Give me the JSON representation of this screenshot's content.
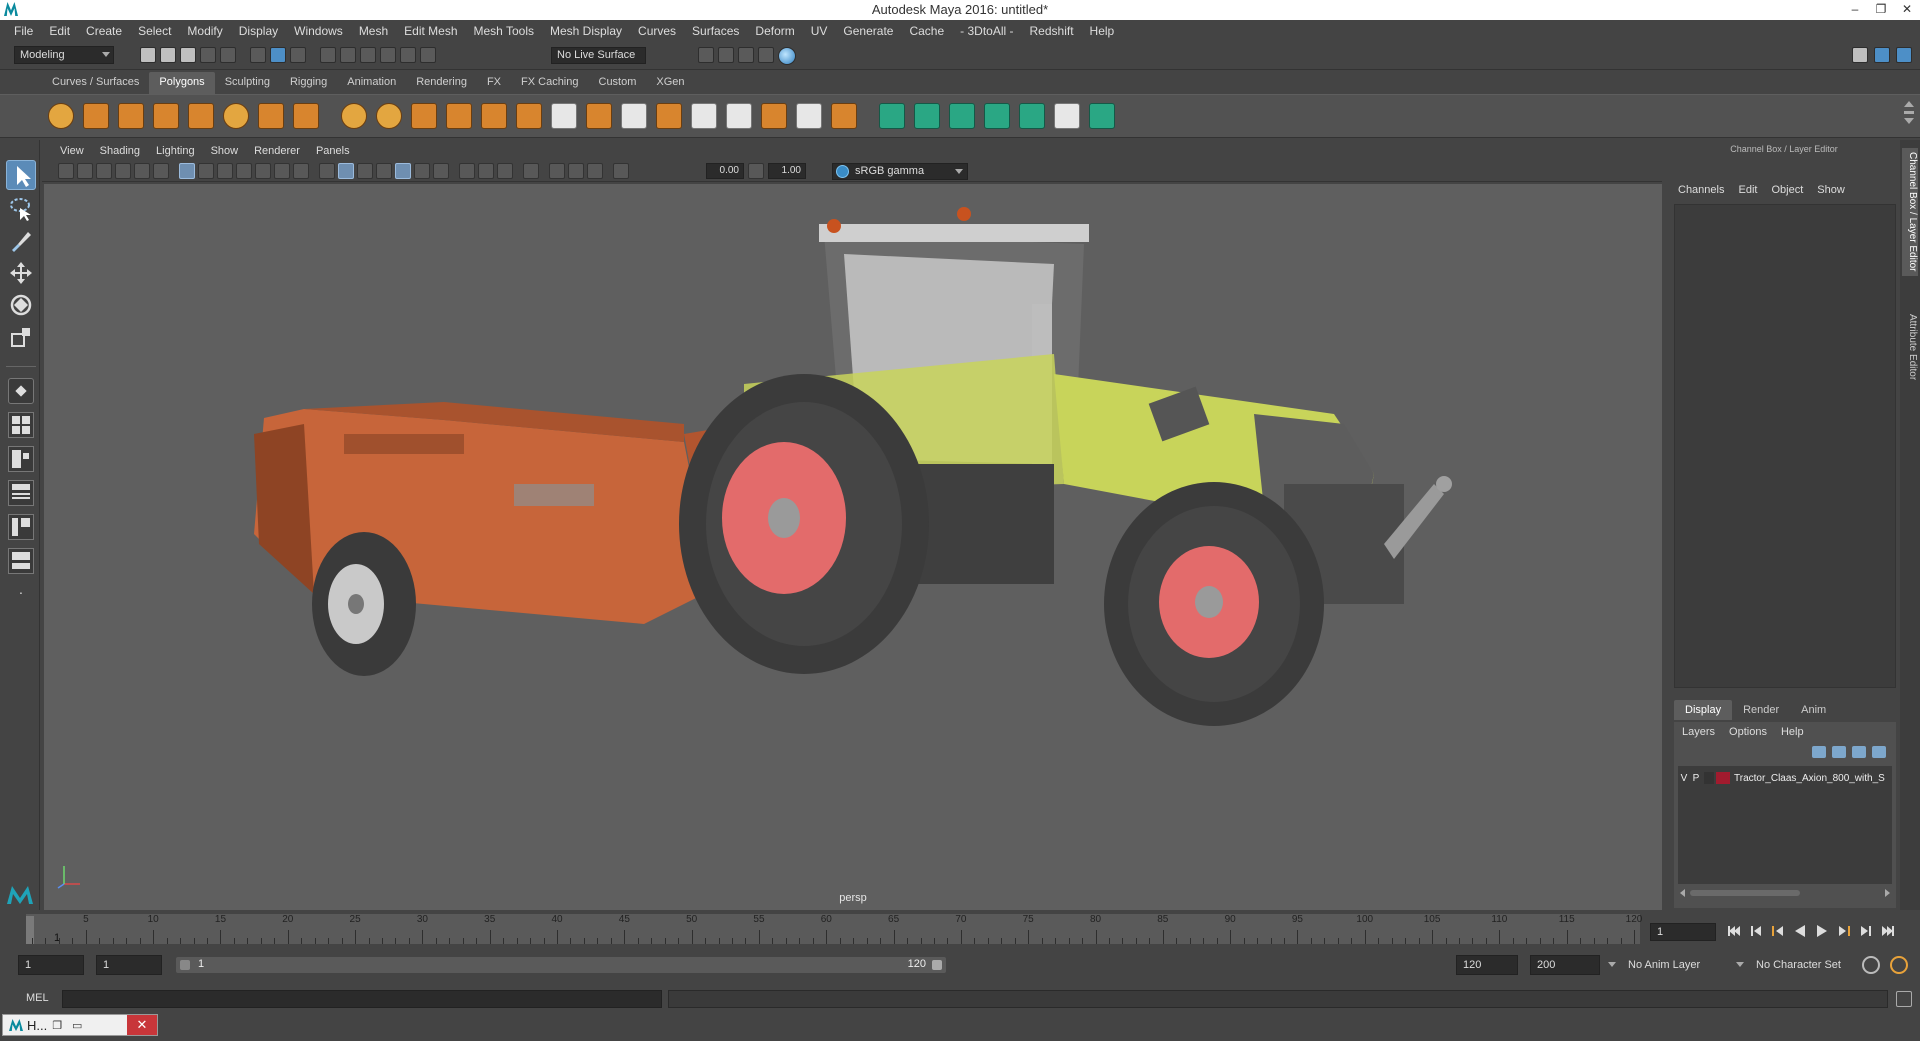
{
  "window": {
    "title": "Autodesk Maya 2016: untitled*",
    "minimize": "–",
    "restore": "❐",
    "close": "✕"
  },
  "menubar": [
    "File",
    "Edit",
    "Create",
    "Select",
    "Modify",
    "Display",
    "Windows",
    "Mesh",
    "Edit Mesh",
    "Mesh Tools",
    "Mesh Display",
    "Curves",
    "Surfaces",
    "Deform",
    "UV",
    "Generate",
    "Cache",
    "- 3DtoAll -",
    "Redshift",
    "Help"
  ],
  "statusline": {
    "mode": "Modeling",
    "live_surface": "No Live Surface"
  },
  "shelf": {
    "tabs": [
      "Curves / Surfaces",
      "Polygons",
      "Sculpting",
      "Rigging",
      "Animation",
      "Rendering",
      "FX",
      "FX Caching",
      "Custom",
      "XGen"
    ],
    "active_tab": "Polygons"
  },
  "viewport": {
    "menus": [
      "View",
      "Shading",
      "Lighting",
      "Show",
      "Renderer",
      "Panels"
    ],
    "near_value": "0.00",
    "far_value": "1.00",
    "color_space": "sRGB gamma",
    "camera_label": "persp"
  },
  "channel_box": {
    "header": "Channel Box / Layer Editor",
    "menus": [
      "Channels",
      "Edit",
      "Object",
      "Show"
    ]
  },
  "layer_editor": {
    "tabs": [
      "Display",
      "Render",
      "Anim"
    ],
    "active_tab": "Display",
    "menus": [
      "Layers",
      "Options",
      "Help"
    ],
    "layers": [
      {
        "visible": "V",
        "playback": "P",
        "color": "#a11b2e",
        "name": "Tractor_Claas_Axion_800_with_S"
      }
    ]
  },
  "side_tabs": [
    "Channel Box / Layer Editor",
    "Attribute Editor"
  ],
  "timeline": {
    "ticks": [
      "5",
      "10",
      "15",
      "20",
      "25",
      "30",
      "35",
      "40",
      "45",
      "50",
      "55",
      "60",
      "65",
      "70",
      "75",
      "80",
      "85",
      "90",
      "95",
      "100",
      "105",
      "110",
      "115",
      "120"
    ],
    "current_frame_label": "1",
    "current_frame": "1"
  },
  "range": {
    "start_time": "1",
    "playback_start": "1",
    "slider_start": "1",
    "slider_end": "120",
    "playback_end": "120",
    "end_time": "200",
    "anim_layer": "No Anim Layer",
    "character_set": "No Character Set"
  },
  "command_line": {
    "language": "MEL"
  },
  "taskbar": {
    "label": "H..."
  },
  "colors": {
    "accent": "#5b8bb8",
    "viewport_bg": "#5f5f5f",
    "tractor_body": "#c8d45a",
    "spreader": "#d26a3c",
    "rims": "#e36b6b"
  }
}
